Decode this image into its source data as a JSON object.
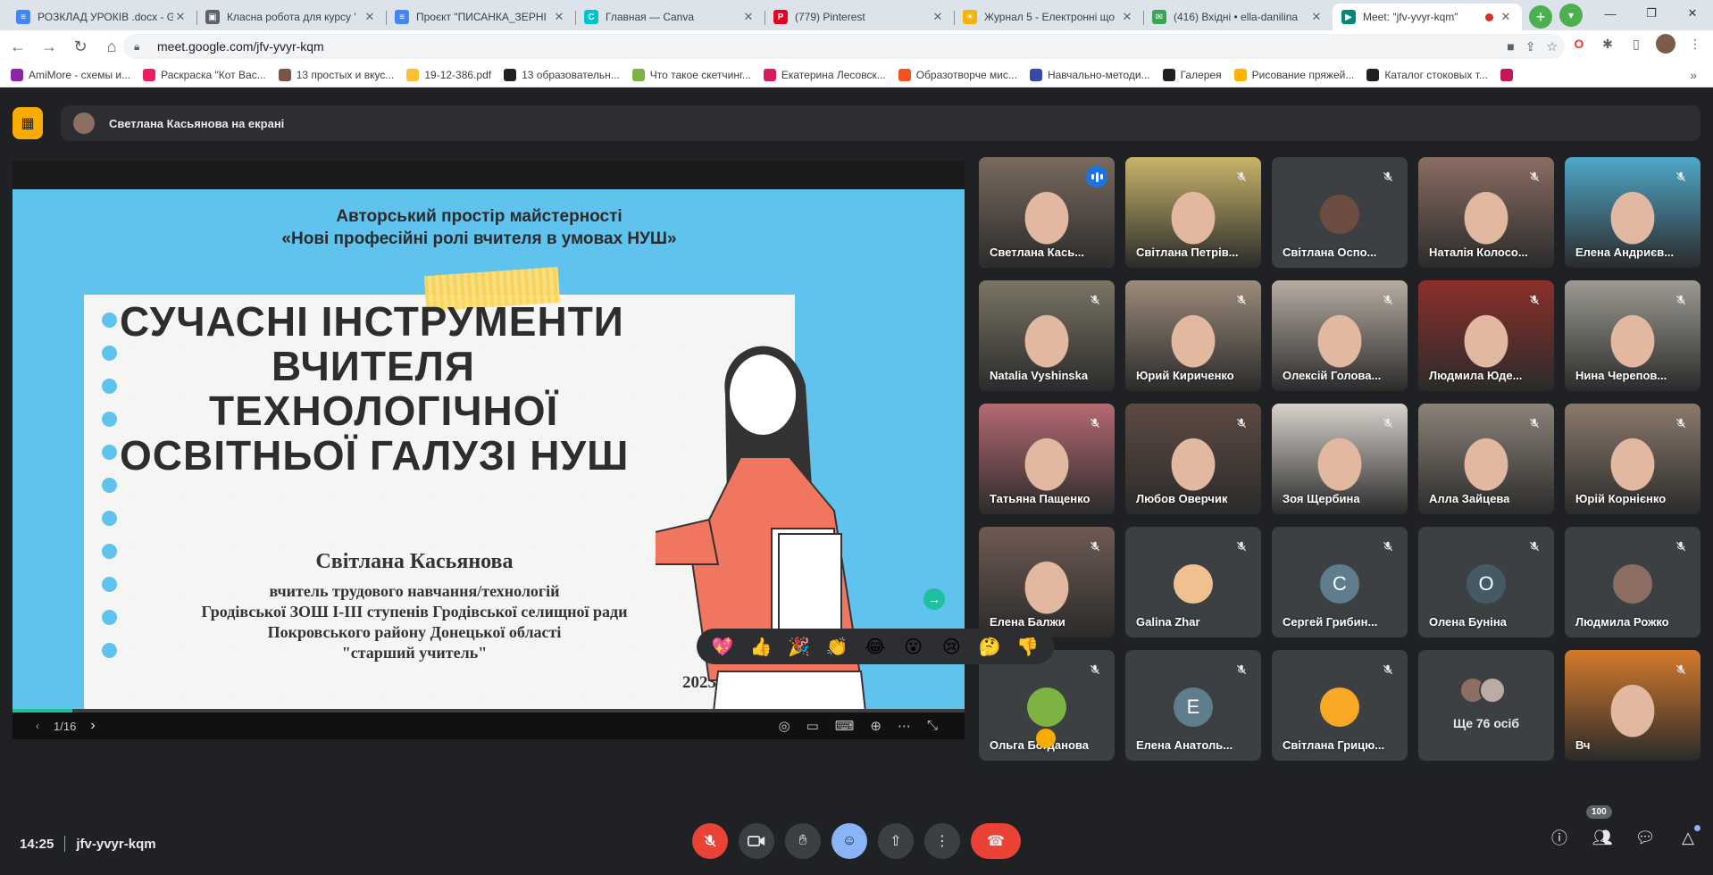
{
  "browser": {
    "tabs": [
      {
        "label": "РОЗКЛАД УРОКІВ .docx - G",
        "color": "#4285f4",
        "glyph": "≡"
      },
      {
        "label": "Класна робота для курсу '",
        "color": "#5f6368",
        "glyph": "▣"
      },
      {
        "label": "Проєкт \"ПИСАНКА_ЗЕРНІ",
        "color": "#4285f4",
        "glyph": "≡"
      },
      {
        "label": "Главная — Canva",
        "color": "#00c4cc",
        "glyph": "C"
      },
      {
        "label": "(779) Pinterest",
        "color": "#e60023",
        "glyph": "P"
      },
      {
        "label": "Журнал 5 - Електронні що",
        "color": "#f4b400",
        "glyph": "☀"
      },
      {
        "label": "(416) Вхідні • ella-danilina",
        "color": "#34a853",
        "glyph": "✉"
      },
      {
        "label": "Meet: \"jfv-yvyr-kqm\"",
        "color": "#00897b",
        "glyph": "▶"
      }
    ],
    "new_tab": "+",
    "url": "meet.google.com/jfv-yvyr-kqm",
    "bookmarks": [
      {
        "label": "AmiMore - схемы и...",
        "color": "#8e24aa"
      },
      {
        "label": "Раскраска \"Кот Вас...",
        "color": "#e91e63"
      },
      {
        "label": "13 простых и вкус...",
        "color": "#795548"
      },
      {
        "label": "19-12-386.pdf",
        "color": "#fbc02d"
      },
      {
        "label": "13 образовательн...",
        "color": "#212121"
      },
      {
        "label": "Что такое скетчинг...",
        "color": "#7cb342"
      },
      {
        "label": "Екатерина Лесовск...",
        "color": "#d81b60"
      },
      {
        "label": "Образотворче мис...",
        "color": "#f4511e"
      },
      {
        "label": "Навчально-методи...",
        "color": "#3949ab"
      },
      {
        "label": "Галерея",
        "color": "#212121"
      },
      {
        "label": "Рисование пряжей...",
        "color": "#ffb300"
      },
      {
        "label": "Каталог стоковых т...",
        "color": "#212121"
      },
      {
        "label": "",
        "color": "#c2185b"
      }
    ]
  },
  "meet": {
    "presenting_label": "Светлана Касьянова на екрані",
    "meeting_code": "jfv-yvyr-kqm",
    "time": "14:25",
    "participants_count": "100",
    "slide": {
      "header_line1": "Авторський простір майстерності",
      "header_line2": "«Нові професійні ролі вчителя в умовах НУШ»",
      "title_lines": [
        "СУЧАСНІ  ІНСТРУМЕНТИ",
        "ВЧИТЕЛЯ",
        "ТЕХНОЛОГІЧНОЇ",
        "ОСВІТНЬОЇ ГАЛУЗІ НУШ"
      ],
      "author_name": "Світлана Касьянова",
      "author_lines": [
        "вчитель трудового навчання/технологій",
        "Гродівської ЗОШ І-ІІІ ступенів Гродівської селищної ради",
        "Покровського району Донецької області",
        "\"старший учитель\""
      ],
      "year": "2023",
      "page_indicator": "1/16",
      "progress": 0.0625
    },
    "tiles": [
      {
        "name": "Светлана Кась...",
        "type": "video",
        "bg": "#7a6a5e",
        "speaking": true
      },
      {
        "name": "Світлана Петрів...",
        "type": "video",
        "bg": "#c9b46a"
      },
      {
        "name": "Світлана Оспо...",
        "type": "avatar",
        "avbg": "#6d4c41"
      },
      {
        "name": "Наталія Колосо...",
        "type": "video",
        "bg": "#8a6d63"
      },
      {
        "name": "Елена Андриєв...",
        "type": "video",
        "bg": "#4fa7c9"
      },
      {
        "name": "Natalia Vyshinska",
        "type": "video",
        "bg": "#7a7465"
      },
      {
        "name": "Юрий Кириченко",
        "type": "video",
        "bg": "#9c8b7a"
      },
      {
        "name": "Олексій Голова...",
        "type": "video",
        "bg": "#b7aca2"
      },
      {
        "name": "Людмила Юде...",
        "type": "video",
        "bg": "#8b2f2a"
      },
      {
        "name": "Нина Черепов...",
        "type": "video",
        "bg": "#9c9a92"
      },
      {
        "name": "Татьяна Пащенко",
        "type": "video",
        "bg": "#b56a72"
      },
      {
        "name": "Любов Оверчик",
        "type": "video",
        "bg": "#5d4a42"
      },
      {
        "name": "Зоя Щербина",
        "type": "video",
        "bg": "#d8d2cc"
      },
      {
        "name": "Алла Зайцева",
        "type": "video",
        "bg": "#8c8378"
      },
      {
        "name": "Юрій Корнієнко",
        "type": "video",
        "bg": "#8a7a6c"
      },
      {
        "name": "Елена Балжи",
        "type": "video",
        "bg": "#6e5a52"
      },
      {
        "name": "Galina Zhar",
        "type": "avatar",
        "avbg": "#f0c090"
      },
      {
        "name": "Сергей Грибин...",
        "type": "letter",
        "letter": "С",
        "avbg": "#5f7d8c"
      },
      {
        "name": "Олена Буніна",
        "type": "letter",
        "letter": "О",
        "avbg": "#455a64"
      },
      {
        "name": "Людмила Рожко",
        "type": "avatar",
        "avbg": "#8d6e63"
      },
      {
        "name": "Ольга Богданова",
        "type": "avatar",
        "avbg": "#7cb342"
      },
      {
        "name": "Елена Анатоль...",
        "type": "letter",
        "letter": "Е",
        "avbg": "#5f7d8c"
      },
      {
        "name": "Світлана Грицю...",
        "type": "avatar",
        "avbg": "#f9a825"
      },
      {
        "name": "Ще 76 осіб",
        "type": "more"
      },
      {
        "name": "Вч",
        "type": "video",
        "bg": "#d47a2c"
      }
    ],
    "reactions": [
      "💖",
      "👍",
      "🎉",
      "👏",
      "😂",
      "😮",
      "😢",
      "🤔",
      "👎"
    ]
  }
}
